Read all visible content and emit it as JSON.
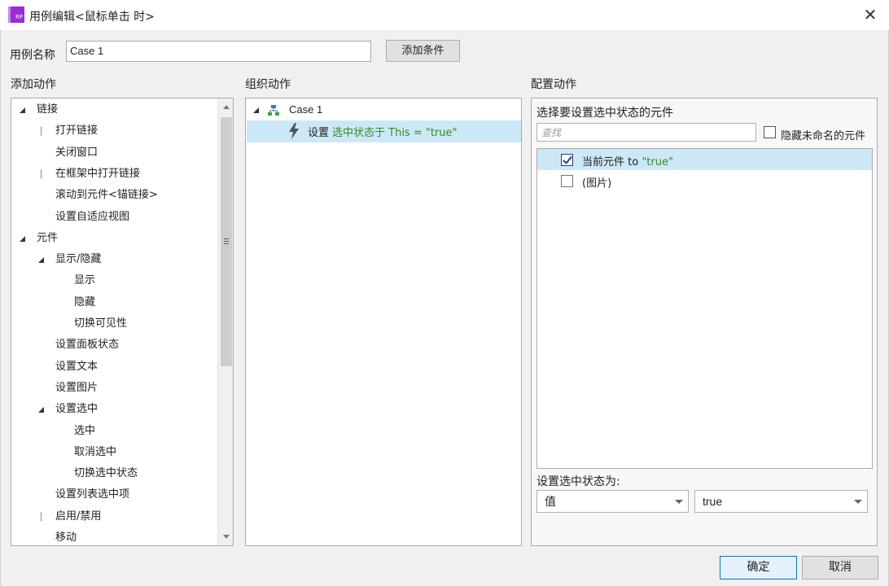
{
  "window": {
    "title": "用例编辑<鼠标单击 时>",
    "app_icon_text": "RP",
    "close_label": "✕"
  },
  "case_name": {
    "label": "用例名称",
    "value": "Case 1",
    "add_condition_label": "添加条件"
  },
  "sections": {
    "add_action": "添加动作",
    "organize_action": "组织动作",
    "configure_action": "配置动作"
  },
  "action_tree": [
    {
      "label": "链接",
      "indent": 0,
      "toggle": "open"
    },
    {
      "label": "打开链接",
      "indent": 1,
      "toggle": "closed"
    },
    {
      "label": "关闭窗口",
      "indent": 1,
      "toggle": "none"
    },
    {
      "label": "在框架中打开链接",
      "indent": 1,
      "toggle": "closed"
    },
    {
      "label": "滚动到元件<锚链接>",
      "indent": 1,
      "toggle": "none"
    },
    {
      "label": "设置自适应视图",
      "indent": 1,
      "toggle": "none"
    },
    {
      "label": "元件",
      "indent": 0,
      "toggle": "open"
    },
    {
      "label": "显示/隐藏",
      "indent": 1,
      "toggle": "open"
    },
    {
      "label": "显示",
      "indent": 2,
      "toggle": "none"
    },
    {
      "label": "隐藏",
      "indent": 2,
      "toggle": "none"
    },
    {
      "label": "切换可见性",
      "indent": 2,
      "toggle": "none"
    },
    {
      "label": "设置面板状态",
      "indent": 1,
      "toggle": "none"
    },
    {
      "label": "设置文本",
      "indent": 1,
      "toggle": "none"
    },
    {
      "label": "设置图片",
      "indent": 1,
      "toggle": "none"
    },
    {
      "label": "设置选中",
      "indent": 1,
      "toggle": "open"
    },
    {
      "label": "选中",
      "indent": 2,
      "toggle": "none"
    },
    {
      "label": "取消选中",
      "indent": 2,
      "toggle": "none"
    },
    {
      "label": "切换选中状态",
      "indent": 2,
      "toggle": "none"
    },
    {
      "label": "设置列表选中项",
      "indent": 1,
      "toggle": "none"
    },
    {
      "label": "启用/禁用",
      "indent": 1,
      "toggle": "closed"
    },
    {
      "label": "移动",
      "indent": 1,
      "toggle": "none"
    }
  ],
  "organize": {
    "case_label": "Case 1",
    "action_prefix": "设置",
    "action_detail": "选中状态于 This = \"true\""
  },
  "configure": {
    "heading": "选择要设置选中状态的元件",
    "search_placeholder": "查找",
    "hide_unnamed_label": "隐藏未命名的元件",
    "hide_unnamed_checked": false,
    "elements": [
      {
        "label": "当前元件 to ",
        "value_text": "\"true\"",
        "checked": true,
        "selected": true
      },
      {
        "label": "(图片)",
        "value_text": "",
        "checked": false,
        "selected": false
      }
    ],
    "set_state_label": "设置选中状态为:",
    "mode_value": "值",
    "state_value": "true"
  },
  "footer": {
    "ok_label": "确定",
    "cancel_label": "取消"
  },
  "colors": {
    "accent_selection": "#cce8f7",
    "green_text": "#2f8f1e",
    "app_icon": "#9b2bd6",
    "default_button_border": "#0078d7"
  }
}
